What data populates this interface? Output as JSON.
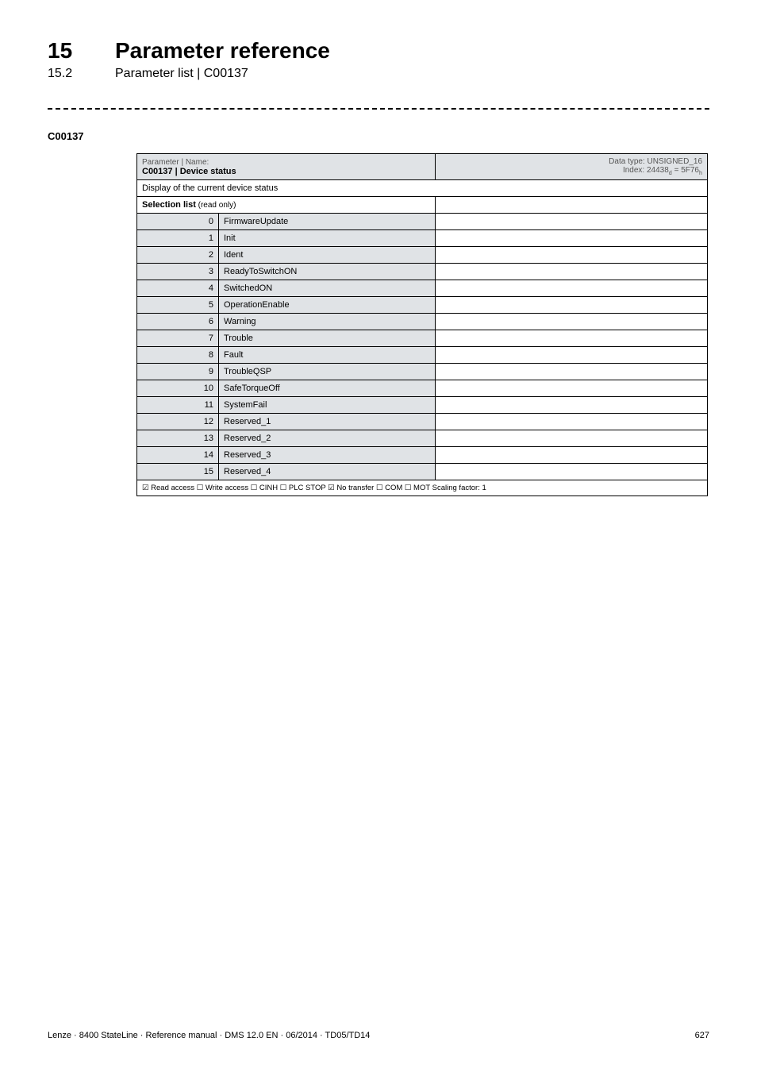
{
  "header": {
    "chapter_num": "15",
    "chapter_title": "Parameter reference",
    "section_num": "15.2",
    "section_title": "Parameter list | C00137"
  },
  "param_code": "C00137",
  "table": {
    "hdr_left_top": "Parameter | Name:",
    "hdr_left_main": "C00137 | Device status",
    "hdr_right_line1": "Data type: UNSIGNED_16",
    "hdr_right_line2_prefix": "Index: 24438",
    "hdr_right_line2_mid": " = 5F76",
    "desc": "Display of the current device status",
    "sel_label": "Selection list",
    "sel_ro": " (read only)",
    "rows": [
      {
        "n": "0",
        "v": "FirmwareUpdate"
      },
      {
        "n": "1",
        "v": "Init"
      },
      {
        "n": "2",
        "v": "Ident"
      },
      {
        "n": "3",
        "v": "ReadyToSwitchON"
      },
      {
        "n": "4",
        "v": "SwitchedON"
      },
      {
        "n": "5",
        "v": "OperationEnable"
      },
      {
        "n": "6",
        "v": "Warning"
      },
      {
        "n": "7",
        "v": "Trouble"
      },
      {
        "n": "8",
        "v": "Fault"
      },
      {
        "n": "9",
        "v": "TroubleQSP"
      },
      {
        "n": "10",
        "v": "SafeTorqueOff"
      },
      {
        "n": "11",
        "v": "SystemFail"
      },
      {
        "n": "12",
        "v": "Reserved_1"
      },
      {
        "n": "13",
        "v": "Reserved_2"
      },
      {
        "n": "14",
        "v": "Reserved_3"
      },
      {
        "n": "15",
        "v": "Reserved_4"
      }
    ],
    "footer": "☑ Read access   ☐ Write access   ☐ CINH   ☐ PLC STOP   ☑ No transfer   ☐ COM   ☐ MOT     Scaling factor: 1"
  },
  "page_footer": {
    "left": "Lenze · 8400 StateLine · Reference manual · DMS 12.0 EN · 06/2014 · TD05/TD14",
    "right": "627"
  }
}
